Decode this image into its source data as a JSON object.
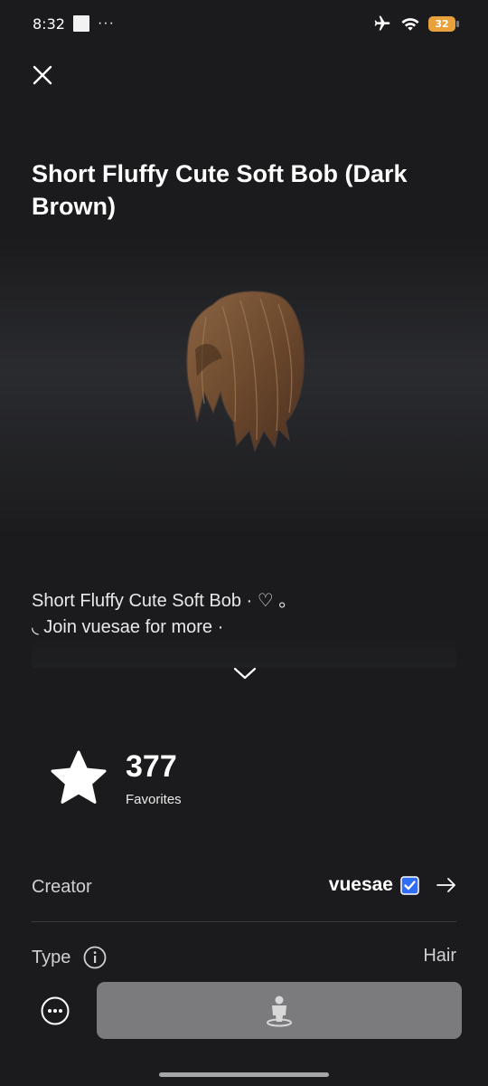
{
  "status_bar": {
    "time": "8:32",
    "more_glyph": "···",
    "battery": "32",
    "icons": [
      "airplane-icon",
      "wifi-icon",
      "battery-icon"
    ]
  },
  "item": {
    "title": "Short Fluffy Cute Soft Bob (Dark Brown)",
    "description_line1": "Short Fluffy Cute Soft Bob · ♡ 。",
    "description_line2": "◟ Join vuesae for more ·"
  },
  "favorites": {
    "count": "377",
    "label": "Favorites"
  },
  "details": {
    "creator_label": "Creator",
    "creator_name": "vuesae",
    "type_label": "Type",
    "type_value": "Hair"
  },
  "colors": {
    "background": "#1b1b1d",
    "verified_badge": "#2f6df6",
    "try_button": "#7b7b7d",
    "hair": "#6e4a2e"
  }
}
